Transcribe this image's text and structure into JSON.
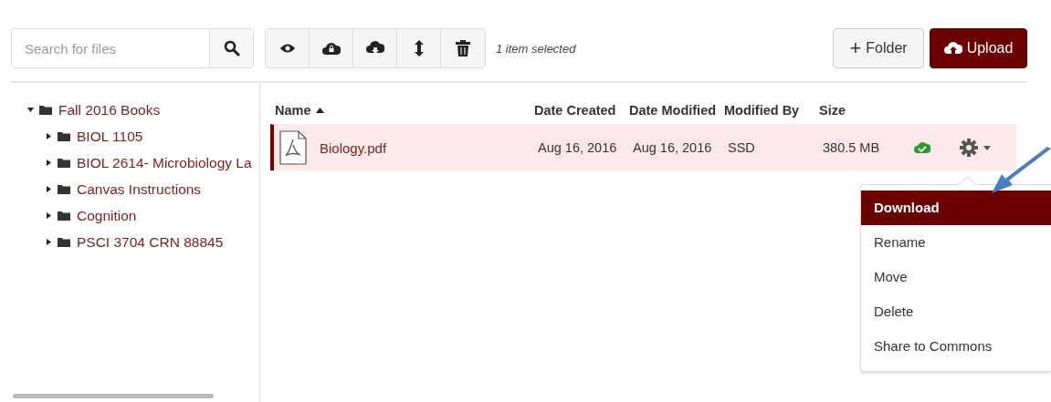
{
  "search": {
    "placeholder": "Search for files"
  },
  "toolbar": {
    "status": "1 item selected"
  },
  "buttons": [
    {
      "kind": "folder",
      "label": "Folder",
      "plus": "+"
    },
    {
      "kind": "upload",
      "label": "Upload"
    }
  ],
  "tree": [
    {
      "label": "Fall 2016 Books",
      "expanded": true,
      "children": [
        {
          "label": "BIOL 1105",
          "expanded": false
        },
        {
          "label": "BIOL 2614- Microbiology La",
          "expanded": false
        },
        {
          "label": "Canvas Instructions",
          "expanded": false
        },
        {
          "label": "Cognition",
          "expanded": false
        },
        {
          "label": "PSCI 3704 CRN 88845",
          "expanded": false
        }
      ]
    }
  ],
  "table": {
    "columns": [
      {
        "label": "Name",
        "sorted": true
      },
      {
        "label": "Date Created",
        "sorted": false
      },
      {
        "label": "Date Modified",
        "sorted": false
      },
      {
        "label": "Modified By",
        "sorted": false
      },
      {
        "label": "Size",
        "sorted": false
      }
    ],
    "rows": [
      {
        "name": "Biology.pdf",
        "date_created": "Aug 16, 2016",
        "date_modified": "Aug 16, 2016",
        "modified_by": "SSD",
        "size": "380.5 MB",
        "selected": true,
        "published": true
      }
    ]
  },
  "menu": {
    "items": [
      {
        "label": "Download",
        "selected": true
      },
      {
        "label": "Rename",
        "selected": false
      },
      {
        "label": "Move",
        "selected": false
      },
      {
        "label": "Delete",
        "selected": false
      },
      {
        "label": "Share to Commons",
        "selected": false
      }
    ]
  }
}
